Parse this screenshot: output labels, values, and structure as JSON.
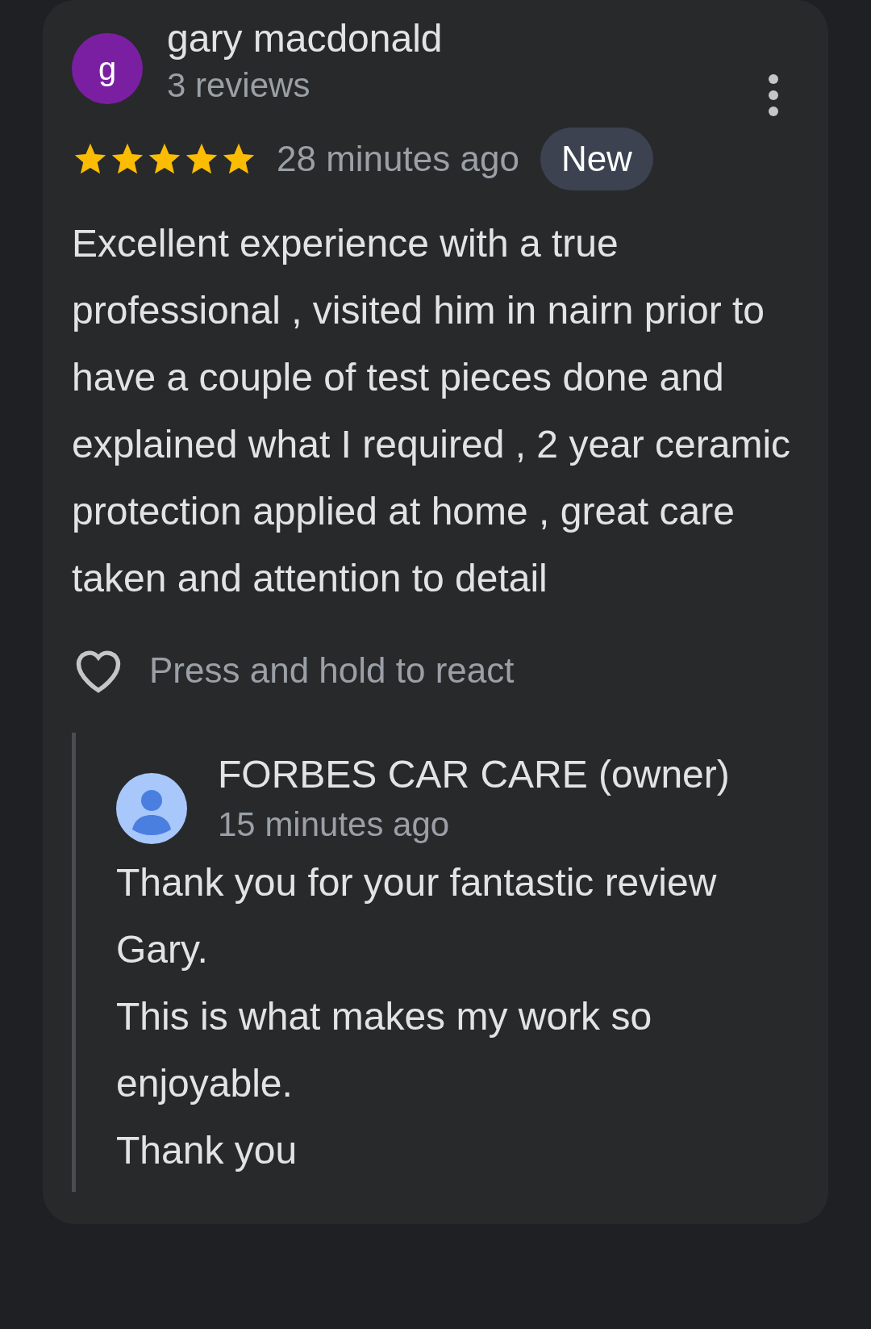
{
  "review": {
    "author": {
      "initial": "g",
      "name": "gary macdonald",
      "reviews": "3 reviews",
      "color": "#7b1fa2"
    },
    "stars": 5,
    "time": "28 minutes ago",
    "badge": "New",
    "text": "Excellent experience with a true professional , visited him in nairn prior to have a couple of test pieces done and explained what I required , 2 year ceramic protection applied at home , great care taken and attention to detail",
    "react": "Press and hold to react",
    "reply": {
      "name": "FORBES CAR CARE (owner)",
      "time": "15 minutes ago",
      "text": "Thank you for your fantastic review Gary.\nThis is what makes my work so enjoyable.\nThank you"
    }
  }
}
